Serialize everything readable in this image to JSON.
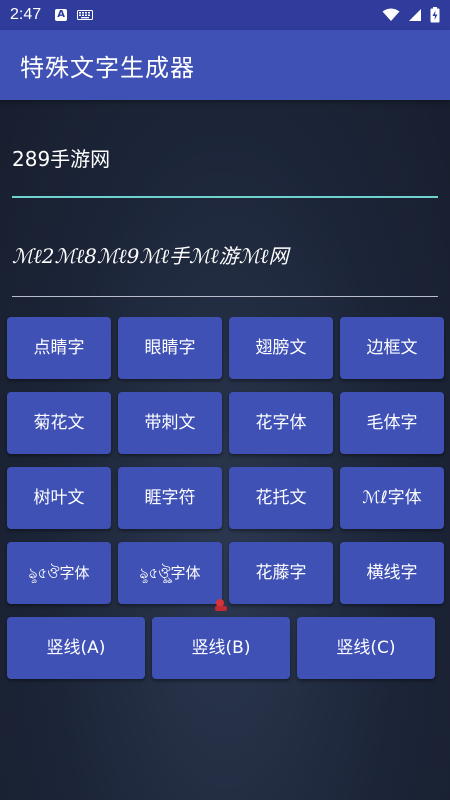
{
  "status_bar": {
    "time": "2:47",
    "a_label": "A"
  },
  "app_bar": {
    "title": "特殊文字生成器"
  },
  "input": {
    "value": "289手游网"
  },
  "output": {
    "text": "ℳℓ2ℳℓ8ℳℓ9ℳℓ手ℳℓ游ℳℓ网"
  },
  "buttons": [
    {
      "label": "点睛字"
    },
    {
      "label": "眼睛字"
    },
    {
      "label": "翅膀文"
    },
    {
      "label": "边框文"
    },
    {
      "label": "菊花文"
    },
    {
      "label": "带刺文"
    },
    {
      "label": "花字体"
    },
    {
      "label": "毛体字"
    },
    {
      "label": "树叶文"
    },
    {
      "label": "睚字符"
    },
    {
      "label": "花托文"
    },
    {
      "label": "ℳℓ字体"
    },
    {
      "label": "ৡ৫ঔ字体"
    },
    {
      "label": "ৡ৫ঔৣ字体"
    },
    {
      "label": "花藤字"
    },
    {
      "label": "横线字"
    }
  ],
  "bottom_buttons": [
    {
      "label": "竖线(A)"
    },
    {
      "label": "竖线(B)"
    },
    {
      "label": "竖线(C)"
    }
  ],
  "colors": {
    "primary": "#3f51b5",
    "primary_dark": "#2f3c9c",
    "accent_line": "#6fd2cf"
  }
}
